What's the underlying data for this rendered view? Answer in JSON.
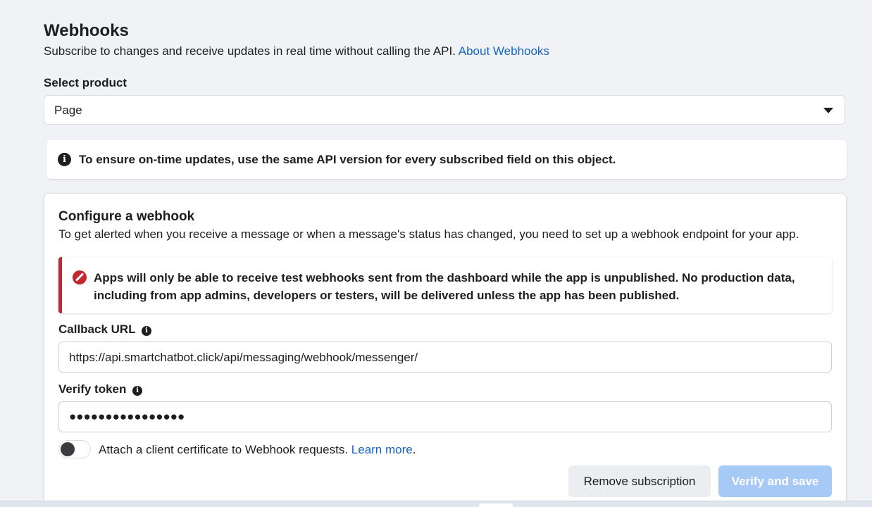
{
  "header": {
    "title": "Webhooks",
    "subtitle": "Subscribe to changes and receive updates in real time without calling the API.",
    "about_link": "About Webhooks"
  },
  "product_select": {
    "label": "Select product",
    "selected": "Page"
  },
  "notice": {
    "text": "To ensure on-time updates, use the same API version for every subscribed field on this object."
  },
  "configure": {
    "title": "Configure a webhook",
    "description": "To get alerted when you receive a message or when a message's status has changed, you need to set up a webhook endpoint for your app.",
    "alert_text": "Apps will only be able to receive test webhooks sent from the dashboard while the app is unpublished. No production data, including from app admins, developers or testers, will be delivered unless the app has been published.",
    "callback_url": {
      "label": "Callback URL",
      "value": "https://api.smartchatbot.click/api/messaging/webhook/messenger/"
    },
    "verify_token": {
      "label": "Verify token",
      "masked_value": "●●●●●●●●●●●●●●●●"
    },
    "client_certificate": {
      "label": "Attach a client certificate to Webhook requests.",
      "learn_more": "Learn more",
      "after_link": ".",
      "enabled": false
    },
    "buttons": {
      "remove": "Remove subscription",
      "verify": "Verify and save"
    }
  },
  "colors": {
    "link": "#1565c0",
    "alert_accent": "#c4262e",
    "verify_button_disabled": "#a7c9f5",
    "page_background": "#f0f2f5"
  },
  "icons": {
    "info": "info-icon",
    "alert": "prohibited-icon",
    "dropdown": "caret-down-icon"
  }
}
